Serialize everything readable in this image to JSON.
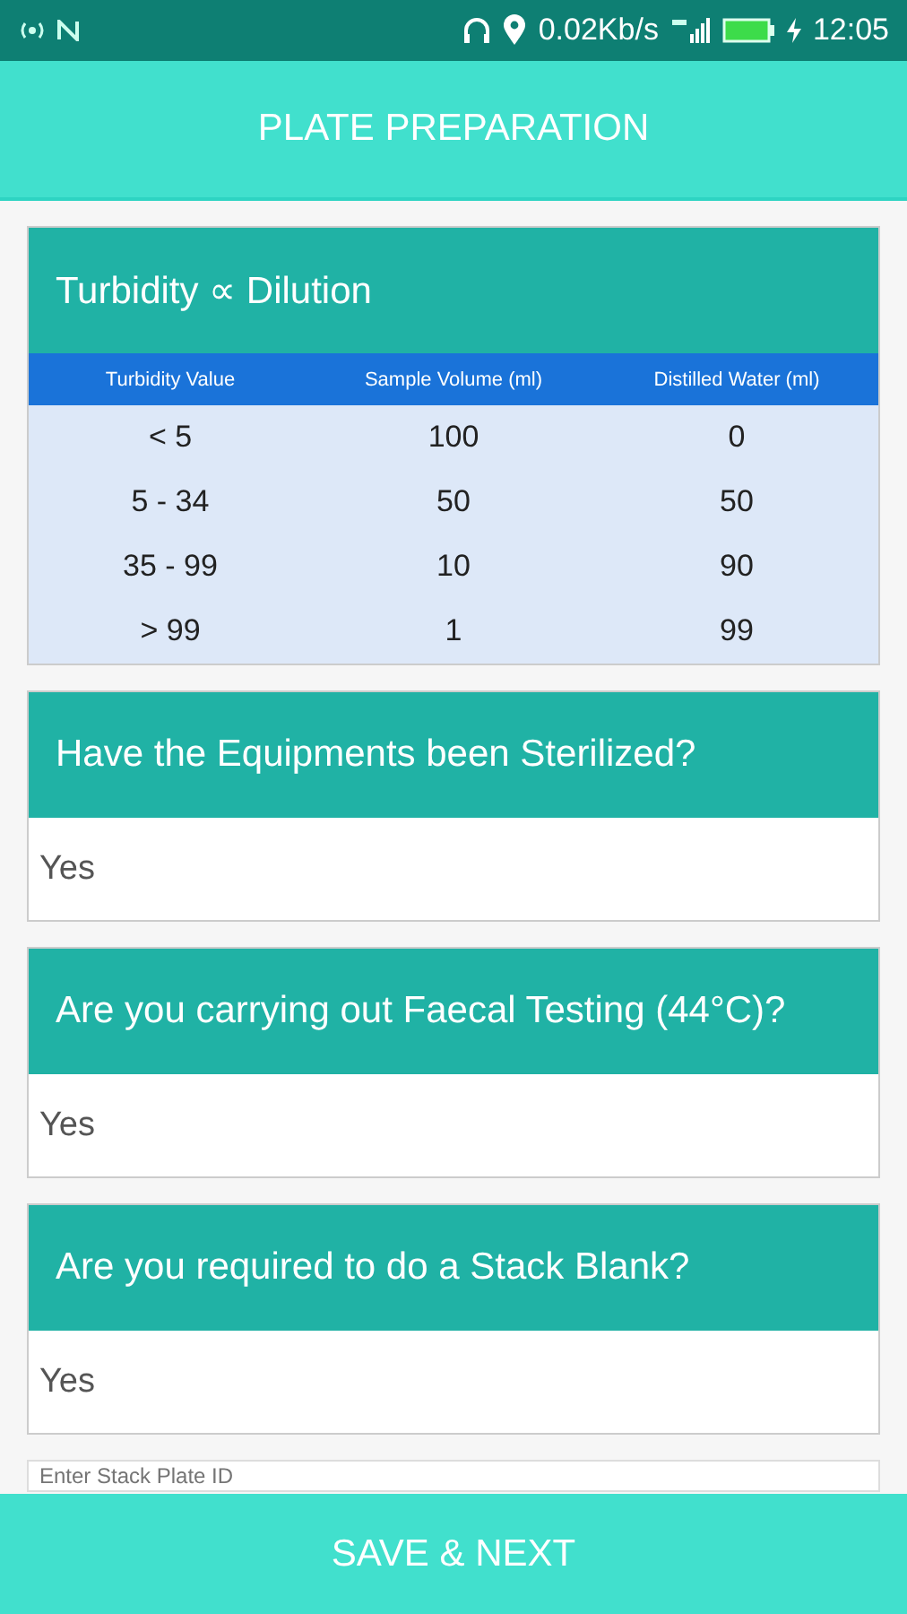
{
  "status_bar": {
    "speed": "0.02Kb/s",
    "time": "12:05"
  },
  "header": {
    "title": "PLATE PREPARATION"
  },
  "dilution_table": {
    "title": "Turbidity ∝ Dilution",
    "columns": [
      "Turbidity Value",
      "Sample Volume (ml)",
      "Distilled Water (ml)"
    ],
    "rows": [
      [
        "< 5",
        "100",
        "0"
      ],
      [
        "5 - 34",
        "50",
        "50"
      ],
      [
        "35 - 99",
        "10",
        "90"
      ],
      [
        "> 99",
        "1",
        "99"
      ]
    ]
  },
  "questions": [
    {
      "question": "Have the Equipments been Sterilized?",
      "answer": "Yes"
    },
    {
      "question": "Are you carrying out Faecal Testing (44°C)?",
      "answer": "Yes"
    },
    {
      "question": "Are you required to do a Stack Blank?",
      "answer": "Yes"
    }
  ],
  "stack_plate_field": {
    "placeholder": "Enter Stack Plate ID"
  },
  "save_button": {
    "label": "SAVE & NEXT"
  }
}
